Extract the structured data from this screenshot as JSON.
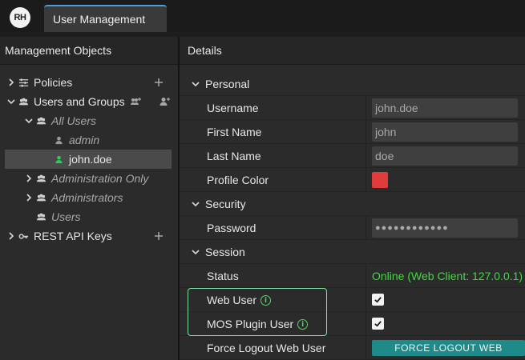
{
  "app": {
    "logo_text": "RH",
    "tab_label": "User Management"
  },
  "left_panel": {
    "title": "Management Objects",
    "tree": {
      "policies": "Policies",
      "users_and_groups": "Users and Groups",
      "all_users": "All Users",
      "admin": "admin",
      "john_doe": "john.doe",
      "administration_only": "Administration Only",
      "administrators": "Administrators",
      "users": "Users",
      "rest_api_keys": "REST API Keys"
    }
  },
  "details": {
    "title": "Details",
    "sections": {
      "personal": "Personal",
      "security": "Security",
      "session": "Session"
    },
    "fields": {
      "username_label": "Username",
      "username_value": "john.doe",
      "first_name_label": "First Name",
      "first_name_value": "john",
      "last_name_label": "Last Name",
      "last_name_value": "doe",
      "profile_color_label": "Profile Color",
      "profile_color": "#e03c3c",
      "password_label": "Password",
      "password_value": "●●●●●●●●●●●●",
      "status_label": "Status",
      "status_value": "Online (Web Client: 127.0.0.1)",
      "web_user_label": "Web User",
      "web_user_checked": true,
      "mos_plugin_user_label": "MOS Plugin User",
      "mos_plugin_user_checked": true,
      "force_logout_label": "Force Logout Web User",
      "force_logout_button": "FORCE LOGOUT WEB USER"
    }
  },
  "colors": {
    "accent": "#4aa0d5",
    "online": "#3ddc3d",
    "button": "#1f8a8a",
    "highlight": "#7fe0a0"
  }
}
